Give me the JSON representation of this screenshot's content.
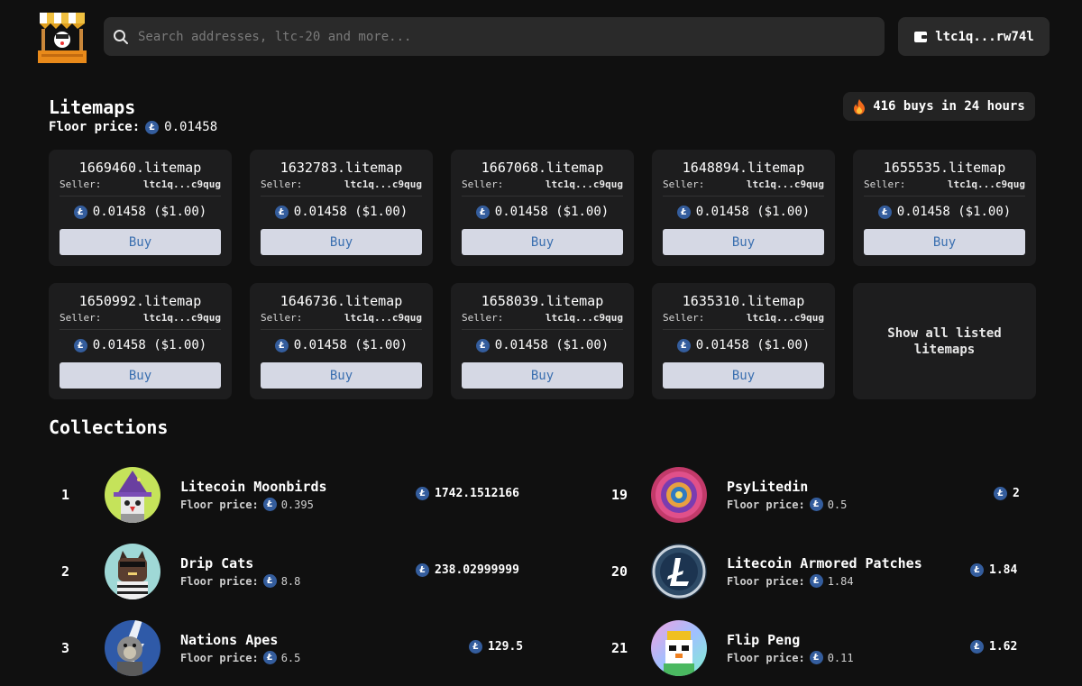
{
  "header": {
    "search_placeholder": "Search addresses, ltc-20 and more...",
    "wallet_label": "ltc1q...rw74l"
  },
  "litemaps": {
    "title": "Litemaps",
    "floor_label": "Floor price:",
    "floor_value": "0.01458",
    "buys_badge": "416 buys in 24 hours",
    "seller_label": "Seller:",
    "buy_label": "Buy",
    "show_all_label": "Show all listed litemaps",
    "cards": [
      {
        "name": "1669460.litemap",
        "seller": "ltc1q...c9qug",
        "price": "0.01458 ($1.00)"
      },
      {
        "name": "1632783.litemap",
        "seller": "ltc1q...c9qug",
        "price": "0.01458 ($1.00)"
      },
      {
        "name": "1667068.litemap",
        "seller": "ltc1q...c9qug",
        "price": "0.01458 ($1.00)"
      },
      {
        "name": "1648894.litemap",
        "seller": "ltc1q...c9qug",
        "price": "0.01458 ($1.00)"
      },
      {
        "name": "1655535.litemap",
        "seller": "ltc1q...c9qug",
        "price": "0.01458 ($1.00)"
      },
      {
        "name": "1650992.litemap",
        "seller": "ltc1q...c9qug",
        "price": "0.01458 ($1.00)"
      },
      {
        "name": "1646736.litemap",
        "seller": "ltc1q...c9qug",
        "price": "0.01458 ($1.00)"
      },
      {
        "name": "1658039.litemap",
        "seller": "ltc1q...c9qug",
        "price": "0.01458 ($1.00)"
      },
      {
        "name": "1635310.litemap",
        "seller": "ltc1q...c9qug",
        "price": "0.01458 ($1.00)"
      }
    ]
  },
  "collections": {
    "title": "Collections",
    "floor_label": "Floor price:",
    "items": [
      {
        "rank": "1",
        "name": "Litecoin Moonbirds",
        "floor": "0.395",
        "volume": "1742.1512166",
        "avatar": "wizard-bird-icon"
      },
      {
        "rank": "2",
        "name": "Drip Cats",
        "floor": "8.8",
        "volume": "238.02999999",
        "avatar": "cat-icon"
      },
      {
        "rank": "3",
        "name": "Nations Apes",
        "floor": "6.5",
        "volume": "129.5",
        "avatar": "ape-icon"
      },
      {
        "rank": "19",
        "name": "PsyLitedin",
        "floor": "0.5",
        "volume": "2",
        "avatar": "psychedelic-icon"
      },
      {
        "rank": "20",
        "name": "Litecoin Armored Patches",
        "floor": "1.84",
        "volume": "1.84",
        "avatar": "litecoin-patch-icon"
      },
      {
        "rank": "21",
        "name": "Flip Peng",
        "floor": "0.11",
        "volume": "1.62",
        "avatar": "penguin-icon"
      }
    ]
  },
  "colors": {
    "background": "#101010",
    "card": "#1d1d1e",
    "ltc_blue": "#345d9d",
    "buy_button_bg": "#d5d8e4",
    "buy_button_text": "#3a6fb0"
  }
}
